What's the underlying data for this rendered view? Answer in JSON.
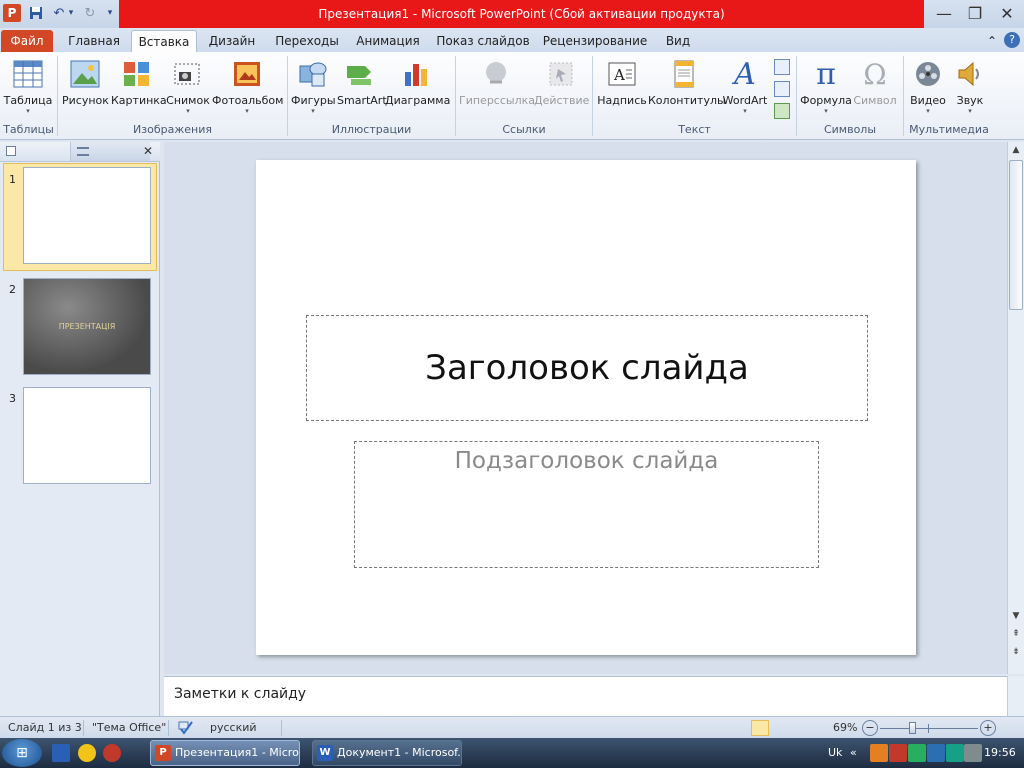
{
  "window": {
    "title": "Презентация1  -  Microsoft PowerPoint (Сбой активации продукта)",
    "app_icon_label": "P",
    "qat": {
      "save": "save-icon",
      "undo": "↶",
      "undo_dd": "▾",
      "redo": "↻",
      "customize": "▾"
    },
    "controls": {
      "minimize": "—",
      "restore": "❐",
      "close": "✕"
    }
  },
  "tabs": [
    {
      "label": "Файл"
    },
    {
      "label": "Главная"
    },
    {
      "label": "Вставка"
    },
    {
      "label": "Дизайн"
    },
    {
      "label": "Переходы"
    },
    {
      "label": "Анимация"
    },
    {
      "label": "Показ слайдов"
    },
    {
      "label": "Рецензирование"
    },
    {
      "label": "Вид"
    }
  ],
  "active_tab": "Вставка",
  "ribbon_right": {
    "minimize": "⌃",
    "help": "?"
  },
  "ribbon": {
    "groups": [
      "Таблицы",
      "Изображения",
      "Иллюстрации",
      "Ссылки",
      "Текст",
      "Символы",
      "Мультимедиа"
    ],
    "buttons": {
      "table": "Таблица",
      "picture": "Рисунок",
      "clipart": "Картинка",
      "screenshot": "Снимок",
      "photoalbum": "Фотоальбом",
      "shapes": "Фигуры",
      "smartart": "SmartArt",
      "chart": "Диаграмма",
      "hyperlink": "Гиперссылка",
      "action": "Действие",
      "textbox": "Надпись",
      "headerfooter": "Колонтитулы",
      "wordart": "WordArt",
      "equation": "Формула",
      "symbol": "Символ",
      "video": "Видео",
      "audio": "Звук"
    },
    "dropdown_marker": "▾",
    "glyphs": {
      "equation": "π",
      "symbol": "Ω",
      "wordart": "A"
    }
  },
  "slide_pane": {
    "tab_close": "✕",
    "thumbnails": [
      {
        "number": "1",
        "selected": true
      },
      {
        "number": "2",
        "text": "ПРЕЗЕНТАЦІЯ"
      },
      {
        "number": "3"
      }
    ]
  },
  "slide": {
    "title": "Заголовок слайда",
    "subtitle": "Подзаголовок слайда"
  },
  "scrollbar": {
    "up": "▲",
    "down": "▼",
    "prev": "⇞",
    "next": "⇟"
  },
  "notes": {
    "placeholder": "Заметки к слайду"
  },
  "status": {
    "slide": "Слайд 1 из 3",
    "theme": "\"Тема Office\"",
    "language": "русский",
    "zoom": "69%",
    "zoom_minus": "−",
    "zoom_plus": "+",
    "zoom_level_percent": 69
  },
  "taskbar": {
    "start": "⊞",
    "tasks": [
      {
        "label": "Презентация1 - Micro...",
        "icon": "P"
      },
      {
        "label": "Документ1 - Microsof...",
        "icon": "W"
      }
    ],
    "lang": "Uk",
    "tray_chevron": "«",
    "time": "19:56"
  },
  "colors": {
    "title_bar_red": "#e81818",
    "file_tab": "#d24726",
    "selected_thumb": "#fbe7a6"
  }
}
